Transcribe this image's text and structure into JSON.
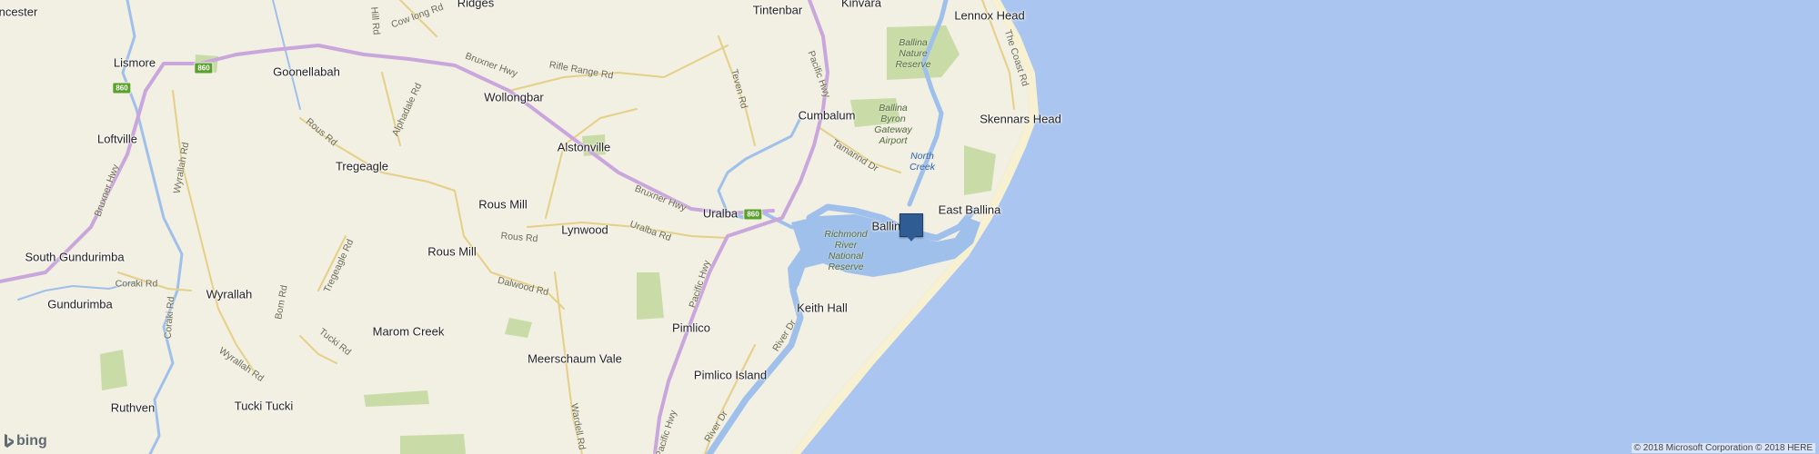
{
  "map": {
    "colors": {
      "land": "#f2efe3",
      "ocean": "#aac6f0",
      "river": "#9fc0ea",
      "park": "#c9dca8",
      "highway": "#c9a6dc",
      "road": "#e6cf86",
      "pin": "#2f5d93"
    },
    "towns": [
      {
        "id": "lismore",
        "name": "Lismore"
      },
      {
        "id": "goonellabah",
        "name": "Goonellabah"
      },
      {
        "id": "wollongbar",
        "name": "Wollongbar"
      },
      {
        "id": "alstonville",
        "name": "Alstonville"
      },
      {
        "id": "tregeagle",
        "name": "Tregeagle"
      },
      {
        "id": "rous-mill-1",
        "name": "Rous Mill"
      },
      {
        "id": "rous-mill-2",
        "name": "Rous Mill"
      },
      {
        "id": "lynwood",
        "name": "Lynwood"
      },
      {
        "id": "uralba",
        "name": "Uralba"
      },
      {
        "id": "loftville",
        "name": "Loftville"
      },
      {
        "id": "south-gundurimba",
        "name": "South Gundurimba"
      },
      {
        "id": "gundurimba",
        "name": "Gundurimba"
      },
      {
        "id": "wyrallah",
        "name": "Wyrallah"
      },
      {
        "id": "marom-creek",
        "name": "Marom Creek"
      },
      {
        "id": "meerschaum-vale",
        "name": "Meerschaum Vale"
      },
      {
        "id": "pimlico",
        "name": "Pimlico"
      },
      {
        "id": "pimlico-island",
        "name": "Pimlico Island"
      },
      {
        "id": "keith-hall",
        "name": "Keith Hall"
      },
      {
        "id": "ruthven",
        "name": "Ruthven"
      },
      {
        "id": "tucki-tucki",
        "name": "Tucki Tucki"
      },
      {
        "id": "cumbalum",
        "name": "Cumbalum"
      },
      {
        "id": "tintenbar",
        "name": "Tintenbar"
      },
      {
        "id": "kinvara",
        "name": "Kinvara"
      },
      {
        "id": "lennox-head",
        "name": "Lennox Head"
      },
      {
        "id": "skennars-head",
        "name": "Skennars Head"
      },
      {
        "id": "east-ballina",
        "name": "East Ballina"
      },
      {
        "id": "ballina",
        "name": "Ballina"
      },
      {
        "id": "ridges",
        "name": "Ridges"
      },
      {
        "id": "lanchester",
        "name": "ncester"
      }
    ],
    "roads": [
      {
        "id": "bruxner-hwy-1",
        "name": "Bruxner Hwy"
      },
      {
        "id": "bruxner-hwy-2",
        "name": "Bruxner Hwy"
      },
      {
        "id": "rifle-range-rd",
        "name": "Rifle Range Rd"
      },
      {
        "id": "pacific-hwy-1",
        "name": "Pacific Hwy"
      },
      {
        "id": "pacific-hwy-2",
        "name": "Pacific Hwy"
      },
      {
        "id": "pacific-hwy-3",
        "name": "Pacific Hwy"
      },
      {
        "id": "teven-rd",
        "name": "Teven Rd"
      },
      {
        "id": "tamarind-dr",
        "name": "Tamarind Dr"
      },
      {
        "id": "the-coast-rd",
        "name": "The Coast Rd"
      },
      {
        "id": "rous-rd",
        "name": "Rous Rd"
      },
      {
        "id": "rous-rd-2",
        "name": "Rous Rd"
      },
      {
        "id": "alphadale-rd",
        "name": "Alphadale Rd"
      },
      {
        "id": "uralba-rd",
        "name": "Uralba Rd"
      },
      {
        "id": "dalwood-rd",
        "name": "Dalwood Rd"
      },
      {
        "id": "wyrallah-rd-1",
        "name": "Wyrallah Rd"
      },
      {
        "id": "wyrallah-rd-2",
        "name": "Wyrallah Rd"
      },
      {
        "id": "bruxner-hwy-3",
        "name": "Bruxner Hwy"
      },
      {
        "id": "coraki-rd-1",
        "name": "Coraki Rd"
      },
      {
        "id": "coraki-rd-2",
        "name": "Coraki Rd"
      },
      {
        "id": "tregeagle-rd",
        "name": "Tregeagle Rd"
      },
      {
        "id": "tucki-rd",
        "name": "Tucki Rd"
      },
      {
        "id": "wardell-rd",
        "name": "Wardell Rd"
      },
      {
        "id": "river-dr-1",
        "name": "River Dr"
      },
      {
        "id": "river-dr-2",
        "name": "River Dr"
      },
      {
        "id": "cow-long-rd",
        "name": "Cow long Rd"
      },
      {
        "id": "hill-rd",
        "name": "Hill Rd"
      },
      {
        "id": "bom-rd",
        "name": "Bom Rd"
      }
    ],
    "parks": [
      {
        "id": "ballina-nature-reserve",
        "name": "Ballina\nNature\nReserve"
      },
      {
        "id": "ballina-byron-airport",
        "name": "Ballina\nByron\nGateway\nAirport"
      },
      {
        "id": "richmond-river-reserve",
        "name": "Richmond\nRiver\nNational\nReserve"
      }
    ],
    "water": [
      {
        "id": "north-creek",
        "name": "North\nCreek"
      }
    ],
    "shields": [
      {
        "id": "shield-860-a",
        "text": "860"
      },
      {
        "id": "shield-860-b",
        "text": "860"
      },
      {
        "id": "shield-860-c",
        "text": "860"
      }
    ],
    "logo": "bing",
    "copyright": "© 2018 Microsoft Corporation © 2018 HERE"
  }
}
